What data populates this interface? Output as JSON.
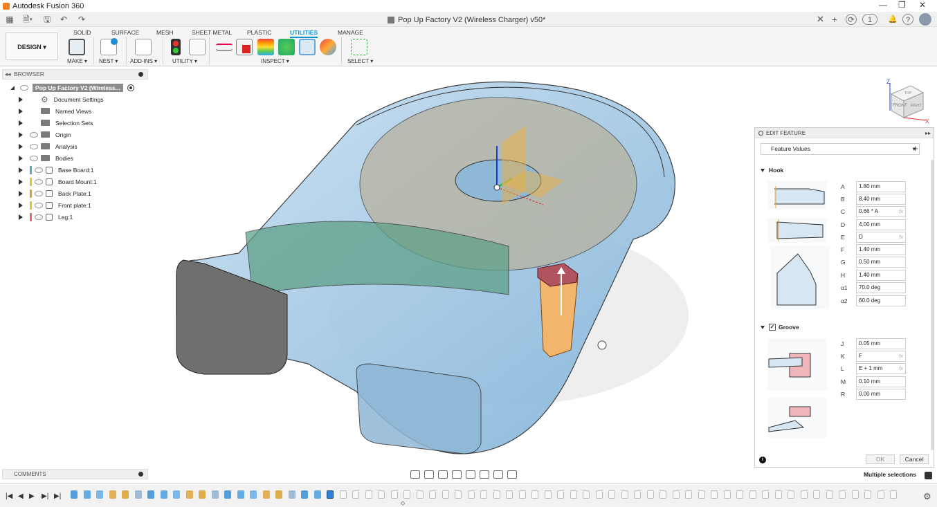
{
  "app": {
    "title": "Autodesk Fusion 360"
  },
  "document": {
    "title": "Pop Up Factory V2 (Wireless Charger) v50*",
    "notifications": "1"
  },
  "toolbar": {
    "workspace": "DESIGN ▾",
    "tabs": [
      "SOLID",
      "SURFACE",
      "MESH",
      "SHEET METAL",
      "PLASTIC",
      "UTILITIES",
      "MANAGE"
    ],
    "active_tab": "UTILITIES",
    "groups": [
      "MAKE ▾",
      "NEST ▾",
      "ADD-INS ▾",
      "UTILITY ▾",
      "INSPECT ▾",
      "SELECT ▾"
    ]
  },
  "browser": {
    "title": "BROWSER",
    "root": "Pop Up Factory V2 (Wireless...",
    "items": [
      {
        "label": "Document Settings",
        "icon": "gear-icon"
      },
      {
        "label": "Named Views",
        "icon": "folder-icon"
      },
      {
        "label": "Selection Sets",
        "icon": "folder-icon"
      },
      {
        "label": "Origin",
        "icon": "folder-icon"
      },
      {
        "label": "Analysis",
        "icon": "folder-icon"
      },
      {
        "label": "Bodies",
        "icon": "folder-icon"
      },
      {
        "label": "Base Board:1",
        "icon": "component-icon",
        "color": "#5aa5d8"
      },
      {
        "label": "Board Mount:1",
        "icon": "component-icon",
        "color": "#e7c13d"
      },
      {
        "label": "Back Plate:1",
        "icon": "component-icon",
        "color": "#e49a3a"
      },
      {
        "label": "Front plate:1",
        "icon": "component-icon",
        "color": "#e7c13d"
      },
      {
        "label": "Leg:1",
        "icon": "component-icon",
        "color": "#e56a6a"
      }
    ]
  },
  "comments": {
    "title": "COMMENTS"
  },
  "panel": {
    "title": "EDIT FEATURE",
    "feature_values": "Feature Values",
    "hook": {
      "title": "Hook",
      "params": [
        {
          "label": "A",
          "value": "1.80 mm",
          "fx": false
        },
        {
          "label": "B",
          "value": "8.40 mm",
          "fx": false
        },
        {
          "label": "C",
          "value": "0.66 * A",
          "fx": true
        },
        {
          "label": "D",
          "value": "4.00 mm",
          "fx": false
        },
        {
          "label": "E",
          "value": "D",
          "fx": true
        },
        {
          "label": "F",
          "value": "1.40 mm",
          "fx": false
        },
        {
          "label": "G",
          "value": "0.50 mm",
          "fx": false
        },
        {
          "label": "H",
          "value": "1.40 mm",
          "fx": false
        },
        {
          "label": "α1",
          "value": "70.0 deg",
          "fx": false
        },
        {
          "label": "α2",
          "value": "60.0 deg",
          "fx": false
        }
      ]
    },
    "groove": {
      "title": "Groove",
      "checked": true,
      "params": [
        {
          "label": "J",
          "value": "0.05 mm",
          "fx": false
        },
        {
          "label": "K",
          "value": "F",
          "fx": true
        },
        {
          "label": "L",
          "value": "E + 1 mm",
          "fx": true
        },
        {
          "label": "M",
          "value": "0.10 mm",
          "fx": false
        },
        {
          "label": "R",
          "value": "0.00 mm",
          "fx": false
        }
      ]
    },
    "fx_label": "fx",
    "ok": "OK",
    "cancel": "Cancel"
  },
  "status": {
    "selection": "Multiple selections"
  },
  "viewcube": {
    "top": "TOP",
    "front": "FRONT",
    "right": "RIGHT",
    "axis_z": "Z",
    "axis_x": "X"
  }
}
